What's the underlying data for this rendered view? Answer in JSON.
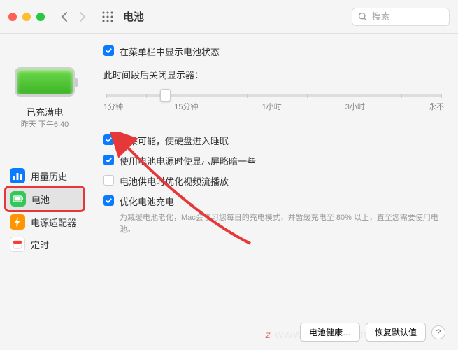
{
  "titlebar": {
    "title": "电池",
    "search_placeholder": "搜索"
  },
  "sidebar": {
    "status_label": "已充满电",
    "status_time": "昨天 下午6:40",
    "items": [
      {
        "label": "用量历史",
        "color": "#0a7aff",
        "icon": "bars"
      },
      {
        "label": "电池",
        "color": "#34c759",
        "icon": "battery"
      },
      {
        "label": "电源适配器",
        "color": "#ff9500",
        "icon": "bolt"
      },
      {
        "label": "定时",
        "color": "#ffffff",
        "icon": "calendar"
      }
    ]
  },
  "main": {
    "show_in_menubar": "在菜单栏中显示电池状态",
    "slider": {
      "label": "此时间段后关闭显示器：",
      "ticks": [
        "1分钟",
        "15分钟",
        "1小时",
        "3小时",
        "永不"
      ]
    },
    "opt_sleep_disk": "如果可能，使硬盘进入睡眠",
    "opt_dim_display": "使用电池电源时使显示屏略暗一些",
    "opt_video_stream": "电池供电时优化视频流播放",
    "opt_optimize_charge": "优化电池充电",
    "opt_optimize_desc": "为减缓电池老化，Mac会学习您每日的充电模式，并暂缓充电至 80% 以上，直至您需要使用电池。"
  },
  "footer": {
    "battery_health": "电池健康…",
    "restore_defaults": "恢复默认值"
  },
  "watermark": "www.MacZ.com"
}
